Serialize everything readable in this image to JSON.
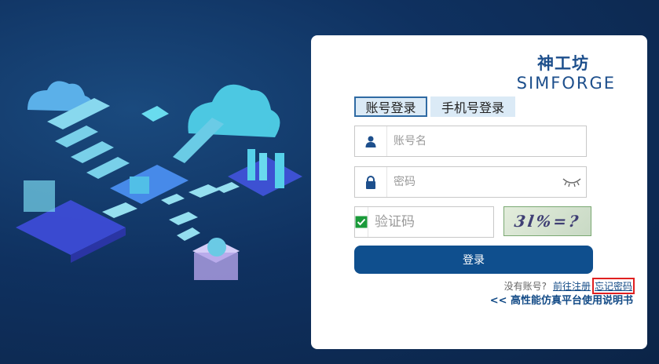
{
  "brand": {
    "cn": "神工坊",
    "en": "SIMFORGE"
  },
  "tabs": {
    "account": "账号登录",
    "phone": "手机号登录"
  },
  "fields": {
    "username_placeholder": "账号名",
    "password_placeholder": "密码",
    "captcha_placeholder": "验证码"
  },
  "captcha": {
    "text": "3l%=?"
  },
  "login_button": "登录",
  "links": {
    "no_account": "没有账号?",
    "register": "前往注册",
    "forgot": "忘记密码",
    "manual": "<< 高性能仿真平台使用说明书"
  },
  "icons": {
    "user": "user-icon",
    "lock": "lock-icon",
    "check": "checkbox-icon",
    "eye": "eye-closed-icon"
  },
  "colors": {
    "brand": "#1d4f8c",
    "button": "#0f4f8e",
    "highlight": "#e02020"
  }
}
